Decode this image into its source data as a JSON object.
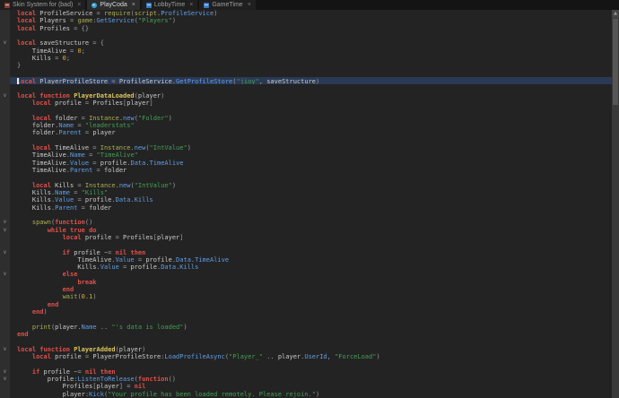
{
  "colors": {
    "bg": "#232323",
    "tabbar": "#141414",
    "gutter": "#2e2e2e",
    "hl": "#2b3954",
    "k": "#e0504a",
    "p": "#cbcbcb",
    "o": "#9e9e9e",
    "s": "#42a152",
    "n": "#e3aa3f",
    "g": "#aeae52",
    "m": "#5f9fe8",
    "f": "#dcc659"
  },
  "tab_close_label": "×",
  "fold_glyph": "∨",
  "tabs": [
    {
      "label": "Skin System for (bad)",
      "icon": "script-icon-red",
      "active": false
    },
    {
      "label": "PlayCoda",
      "icon": "place-icon",
      "active": true
    },
    {
      "label": "LobbyTime",
      "icon": "script-icon-blue",
      "active": false
    },
    {
      "label": "GameTime",
      "icon": "script-icon-blue",
      "active": false
    }
  ],
  "editor": {
    "highlighted_line": 10,
    "caret_line": 10,
    "lines": [
      {
        "fold": false,
        "tokens": [
          [
            "k",
            "local"
          ],
          [
            "p",
            " ProfileService "
          ],
          [
            "o",
            "= "
          ],
          [
            "g",
            "require"
          ],
          [
            "o",
            "("
          ],
          [
            "g",
            "script"
          ],
          [
            "o",
            "."
          ],
          [
            "m",
            "ProfileService"
          ],
          [
            "o",
            ")"
          ]
        ]
      },
      {
        "fold": false,
        "tokens": [
          [
            "k",
            "local"
          ],
          [
            "p",
            " Players "
          ],
          [
            "o",
            "= "
          ],
          [
            "g",
            "game"
          ],
          [
            "o",
            ":"
          ],
          [
            "m",
            "GetService"
          ],
          [
            "o",
            "("
          ],
          [
            "s",
            "\"Players\""
          ],
          [
            "o",
            ")"
          ]
        ]
      },
      {
        "fold": false,
        "tokens": [
          [
            "k",
            "local"
          ],
          [
            "p",
            " Profiles "
          ],
          [
            "o",
            "= "
          ],
          [
            "o",
            "{}"
          ]
        ]
      },
      {
        "fold": false,
        "tokens": []
      },
      {
        "fold": true,
        "tokens": [
          [
            "k",
            "local"
          ],
          [
            "p",
            " saveStructure "
          ],
          [
            "o",
            "= "
          ],
          [
            "o",
            "{"
          ]
        ]
      },
      {
        "fold": false,
        "tokens": [
          [
            "p",
            "    TimeAlive "
          ],
          [
            "o",
            "= "
          ],
          [
            "n",
            "0"
          ],
          [
            "o",
            ";"
          ]
        ]
      },
      {
        "fold": false,
        "tokens": [
          [
            "p",
            "    Kills "
          ],
          [
            "o",
            "= "
          ],
          [
            "n",
            "0"
          ],
          [
            "o",
            ";"
          ]
        ]
      },
      {
        "fold": false,
        "tokens": [
          [
            "o",
            "}"
          ]
        ]
      },
      {
        "fold": false,
        "tokens": []
      },
      {
        "fold": false,
        "tokens": [
          [
            "k",
            "local"
          ],
          [
            "p",
            " PlayerProfileStore "
          ],
          [
            "o",
            "= "
          ],
          [
            "p",
            "ProfileService"
          ],
          [
            "o",
            "."
          ],
          [
            "m",
            "GetProfileStore"
          ],
          [
            "o",
            "("
          ],
          [
            "s",
            "\"jioy\""
          ],
          [
            "o",
            ", "
          ],
          [
            "p",
            "saveStructure"
          ],
          [
            "o",
            ")"
          ]
        ]
      },
      {
        "fold": false,
        "tokens": []
      },
      {
        "fold": true,
        "tokens": [
          [
            "k",
            "local function "
          ],
          [
            "f",
            "PlayerDataLoaded"
          ],
          [
            "o",
            "("
          ],
          [
            "p",
            "player"
          ],
          [
            "o",
            ")"
          ]
        ]
      },
      {
        "fold": false,
        "tokens": [
          [
            "p",
            "    "
          ],
          [
            "k",
            "local"
          ],
          [
            "p",
            " profile "
          ],
          [
            "o",
            "= "
          ],
          [
            "p",
            "Profiles"
          ],
          [
            "o",
            "["
          ],
          [
            "p",
            "player"
          ],
          [
            "o",
            "]"
          ]
        ]
      },
      {
        "fold": false,
        "tokens": []
      },
      {
        "fold": false,
        "tokens": [
          [
            "p",
            "    "
          ],
          [
            "k",
            "local"
          ],
          [
            "p",
            " folder "
          ],
          [
            "o",
            "= "
          ],
          [
            "g",
            "Instance"
          ],
          [
            "o",
            "."
          ],
          [
            "m",
            "new"
          ],
          [
            "o",
            "("
          ],
          [
            "s",
            "\"Folder\""
          ],
          [
            "o",
            ")"
          ]
        ]
      },
      {
        "fold": false,
        "tokens": [
          [
            "p",
            "    folder"
          ],
          [
            "o",
            "."
          ],
          [
            "m",
            "Name"
          ],
          [
            "o",
            " = "
          ],
          [
            "s",
            "\"leaderstats\""
          ]
        ]
      },
      {
        "fold": false,
        "tokens": [
          [
            "p",
            "    folder"
          ],
          [
            "o",
            "."
          ],
          [
            "m",
            "Parent"
          ],
          [
            "o",
            " = "
          ],
          [
            "p",
            "player"
          ]
        ]
      },
      {
        "fold": false,
        "tokens": []
      },
      {
        "fold": false,
        "tokens": [
          [
            "p",
            "    "
          ],
          [
            "k",
            "local"
          ],
          [
            "p",
            " TimeAlive "
          ],
          [
            "o",
            "= "
          ],
          [
            "g",
            "Instance"
          ],
          [
            "o",
            "."
          ],
          [
            "m",
            "new"
          ],
          [
            "o",
            "("
          ],
          [
            "s",
            "\"IntValue\""
          ],
          [
            "o",
            ")"
          ]
        ]
      },
      {
        "fold": false,
        "tokens": [
          [
            "p",
            "    TimeAlive"
          ],
          [
            "o",
            "."
          ],
          [
            "m",
            "Name"
          ],
          [
            "o",
            " = "
          ],
          [
            "s",
            "\"TimeAlive\""
          ]
        ]
      },
      {
        "fold": false,
        "tokens": [
          [
            "p",
            "    TimeAlive"
          ],
          [
            "o",
            "."
          ],
          [
            "m",
            "Value"
          ],
          [
            "o",
            " = "
          ],
          [
            "p",
            "profile"
          ],
          [
            "o",
            "."
          ],
          [
            "m",
            "Data"
          ],
          [
            "o",
            "."
          ],
          [
            "m",
            "TimeAlive"
          ]
        ]
      },
      {
        "fold": false,
        "tokens": [
          [
            "p",
            "    TimeAlive"
          ],
          [
            "o",
            "."
          ],
          [
            "m",
            "Parent"
          ],
          [
            "o",
            " = "
          ],
          [
            "p",
            "folder"
          ]
        ]
      },
      {
        "fold": false,
        "tokens": []
      },
      {
        "fold": false,
        "tokens": [
          [
            "p",
            "    "
          ],
          [
            "k",
            "local"
          ],
          [
            "p",
            " Kills "
          ],
          [
            "o",
            "= "
          ],
          [
            "g",
            "Instance"
          ],
          [
            "o",
            "."
          ],
          [
            "m",
            "new"
          ],
          [
            "o",
            "("
          ],
          [
            "s",
            "\"IntValue\""
          ],
          [
            "o",
            ")"
          ]
        ]
      },
      {
        "fold": false,
        "tokens": [
          [
            "p",
            "    Kills"
          ],
          [
            "o",
            "."
          ],
          [
            "m",
            "Name"
          ],
          [
            "o",
            " = "
          ],
          [
            "s",
            "\"Kills\""
          ]
        ]
      },
      {
        "fold": false,
        "tokens": [
          [
            "p",
            "    Kills"
          ],
          [
            "o",
            "."
          ],
          [
            "m",
            "Value"
          ],
          [
            "o",
            " = "
          ],
          [
            "p",
            "profile"
          ],
          [
            "o",
            "."
          ],
          [
            "m",
            "Data"
          ],
          [
            "o",
            "."
          ],
          [
            "m",
            "Kills"
          ]
        ]
      },
      {
        "fold": false,
        "tokens": [
          [
            "p",
            "    Kills"
          ],
          [
            "o",
            "."
          ],
          [
            "m",
            "Parent"
          ],
          [
            "o",
            " = "
          ],
          [
            "p",
            "folder"
          ]
        ]
      },
      {
        "fold": false,
        "tokens": []
      },
      {
        "fold": true,
        "tokens": [
          [
            "p",
            "    "
          ],
          [
            "g",
            "spawn"
          ],
          [
            "o",
            "("
          ],
          [
            "k",
            "function"
          ],
          [
            "o",
            "()"
          ]
        ]
      },
      {
        "fold": true,
        "tokens": [
          [
            "p",
            "        "
          ],
          [
            "k",
            "while "
          ],
          [
            "k",
            "true "
          ],
          [
            "k",
            "do"
          ]
        ]
      },
      {
        "fold": false,
        "tokens": [
          [
            "p",
            "            "
          ],
          [
            "k",
            "local"
          ],
          [
            "p",
            " profile "
          ],
          [
            "o",
            "= "
          ],
          [
            "p",
            "Profiles"
          ],
          [
            "o",
            "["
          ],
          [
            "p",
            "player"
          ],
          [
            "o",
            "]"
          ]
        ]
      },
      {
        "fold": false,
        "tokens": []
      },
      {
        "fold": true,
        "tokens": [
          [
            "p",
            "            "
          ],
          [
            "k",
            "if"
          ],
          [
            "p",
            " profile "
          ],
          [
            "o",
            "~= "
          ],
          [
            "k",
            "nil"
          ],
          [
            "p",
            " "
          ],
          [
            "k",
            "then"
          ]
        ]
      },
      {
        "fold": false,
        "tokens": [
          [
            "p",
            "                TimeAlive"
          ],
          [
            "o",
            "."
          ],
          [
            "m",
            "Value"
          ],
          [
            "o",
            " = "
          ],
          [
            "p",
            "profile"
          ],
          [
            "o",
            "."
          ],
          [
            "m",
            "Data"
          ],
          [
            "o",
            "."
          ],
          [
            "m",
            "TimeAlive"
          ]
        ]
      },
      {
        "fold": false,
        "tokens": [
          [
            "p",
            "                Kills"
          ],
          [
            "o",
            "."
          ],
          [
            "m",
            "Value"
          ],
          [
            "o",
            " = "
          ],
          [
            "p",
            "profile"
          ],
          [
            "o",
            "."
          ],
          [
            "m",
            "Data"
          ],
          [
            "o",
            "."
          ],
          [
            "m",
            "Kills"
          ]
        ]
      },
      {
        "fold": true,
        "tokens": [
          [
            "p",
            "            "
          ],
          [
            "k",
            "else"
          ]
        ]
      },
      {
        "fold": false,
        "tokens": [
          [
            "p",
            "                "
          ],
          [
            "k",
            "break"
          ]
        ]
      },
      {
        "fold": false,
        "tokens": [
          [
            "p",
            "            "
          ],
          [
            "k",
            "end"
          ]
        ]
      },
      {
        "fold": false,
        "tokens": [
          [
            "p",
            "            "
          ],
          [
            "g",
            "wait"
          ],
          [
            "o",
            "("
          ],
          [
            "n",
            "0.1"
          ],
          [
            "o",
            ")"
          ]
        ]
      },
      {
        "fold": false,
        "tokens": [
          [
            "p",
            "        "
          ],
          [
            "k",
            "end"
          ]
        ]
      },
      {
        "fold": false,
        "tokens": [
          [
            "p",
            "    "
          ],
          [
            "k",
            "end"
          ],
          [
            "o",
            ")"
          ]
        ]
      },
      {
        "fold": false,
        "tokens": []
      },
      {
        "fold": false,
        "tokens": [
          [
            "p",
            "    "
          ],
          [
            "g",
            "print"
          ],
          [
            "o",
            "("
          ],
          [
            "p",
            "player"
          ],
          [
            "o",
            "."
          ],
          [
            "m",
            "Name"
          ],
          [
            "o",
            " .. "
          ],
          [
            "s",
            "\"'s data is loaded\""
          ],
          [
            "o",
            ")"
          ]
        ]
      },
      {
        "fold": false,
        "tokens": [
          [
            "k",
            "end"
          ]
        ]
      },
      {
        "fold": false,
        "tokens": []
      },
      {
        "fold": true,
        "tokens": [
          [
            "k",
            "local function "
          ],
          [
            "f",
            "PlayerAdded"
          ],
          [
            "o",
            "("
          ],
          [
            "p",
            "player"
          ],
          [
            "o",
            ")"
          ]
        ]
      },
      {
        "fold": false,
        "tokens": [
          [
            "p",
            "    "
          ],
          [
            "k",
            "local"
          ],
          [
            "p",
            " profile "
          ],
          [
            "o",
            "= "
          ],
          [
            "p",
            "PlayerProfileStore"
          ],
          [
            "o",
            ":"
          ],
          [
            "m",
            "LoadProfileAsync"
          ],
          [
            "o",
            "("
          ],
          [
            "s",
            "\"Player_\""
          ],
          [
            "o",
            " .. "
          ],
          [
            "p",
            "player"
          ],
          [
            "o",
            "."
          ],
          [
            "m",
            "UserId"
          ],
          [
            "o",
            ", "
          ],
          [
            "s",
            "\"ForceLoad\""
          ],
          [
            "o",
            ")"
          ]
        ]
      },
      {
        "fold": false,
        "tokens": []
      },
      {
        "fold": true,
        "tokens": [
          [
            "p",
            "    "
          ],
          [
            "k",
            "if"
          ],
          [
            "p",
            " profile "
          ],
          [
            "o",
            "~= "
          ],
          [
            "k",
            "nil"
          ],
          [
            "p",
            " "
          ],
          [
            "k",
            "then"
          ]
        ]
      },
      {
        "fold": true,
        "tokens": [
          [
            "p",
            "        profile"
          ],
          [
            "o",
            ":"
          ],
          [
            "m",
            "ListenToRelease"
          ],
          [
            "o",
            "("
          ],
          [
            "k",
            "function"
          ],
          [
            "o",
            "()"
          ]
        ]
      },
      {
        "fold": false,
        "tokens": [
          [
            "p",
            "            Profiles"
          ],
          [
            "o",
            "["
          ],
          [
            "p",
            "player"
          ],
          [
            "o",
            "] = "
          ],
          [
            "k",
            "nil"
          ]
        ]
      },
      {
        "fold": false,
        "tokens": [
          [
            "p",
            "            player"
          ],
          [
            "o",
            ":"
          ],
          [
            "m",
            "Kick"
          ],
          [
            "o",
            "("
          ],
          [
            "s",
            "\"Your profile has been loaded remotely. Please rejoin.\""
          ],
          [
            "o",
            ")"
          ]
        ]
      }
    ]
  },
  "scrollbar": {
    "up_arrow": "▲"
  }
}
